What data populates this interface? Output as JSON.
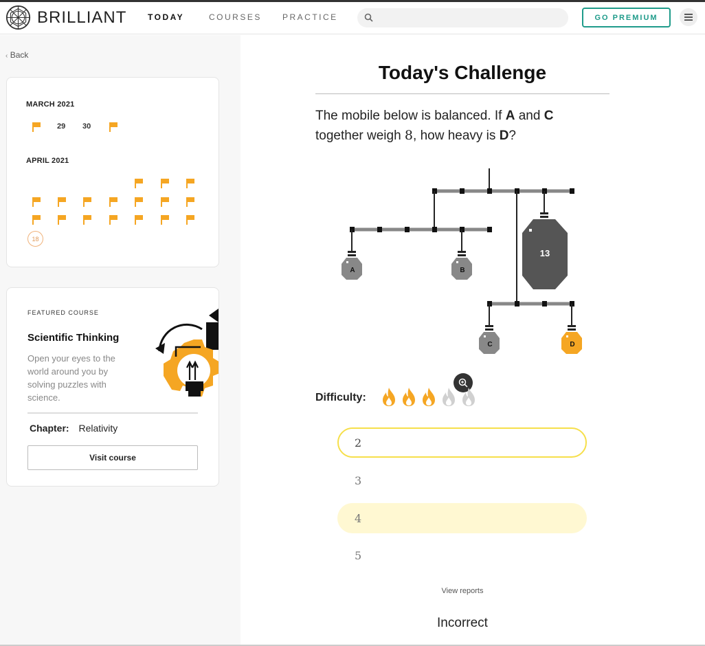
{
  "header": {
    "brand": "BRILLIANT",
    "nav": [
      {
        "label": "TODAY"
      },
      {
        "label": "COURSES"
      },
      {
        "label": "PRACTICE"
      }
    ],
    "search_placeholder": "",
    "premium_label": "GO PREMIUM",
    "accent_color": "#1e9b8a"
  },
  "sidebar": {
    "back_label": "Back",
    "calendar": {
      "months": [
        {
          "label": "MARCH 2021",
          "days": [
            "29",
            "30"
          ]
        },
        {
          "label": "APRIL 2021",
          "today": "18"
        }
      ],
      "flag_color": "#f5a623"
    },
    "featured": {
      "label": "FEATURED COURSE",
      "title": "Scientific Thinking",
      "description": "Open your eyes to the world around you by solving puzzles with science.",
      "chapter_label": "Chapter:",
      "chapter_value": "Relativity",
      "visit_label": "Visit course"
    }
  },
  "main": {
    "title": "Today's Challenge",
    "question": {
      "p1": "The mobile below is balanced. If ",
      "a": "A",
      "p2": " and ",
      "c": "C",
      "p3": " together weigh ",
      "num": "8",
      "p4": ", how heavy is ",
      "d": "D",
      "p5": "?"
    },
    "diagram": {
      "weights": [
        {
          "label": "A"
        },
        {
          "label": "B"
        },
        {
          "label": "13"
        },
        {
          "label": "C"
        },
        {
          "label": "D"
        }
      ]
    },
    "difficulty_label": "Difficulty:",
    "difficulty_level": 3,
    "difficulty_max": 5,
    "options": [
      {
        "label": "2"
      },
      {
        "label": "3"
      },
      {
        "label": "4"
      },
      {
        "label": "5"
      }
    ],
    "view_reports": "View reports",
    "result": "Incorrect"
  }
}
